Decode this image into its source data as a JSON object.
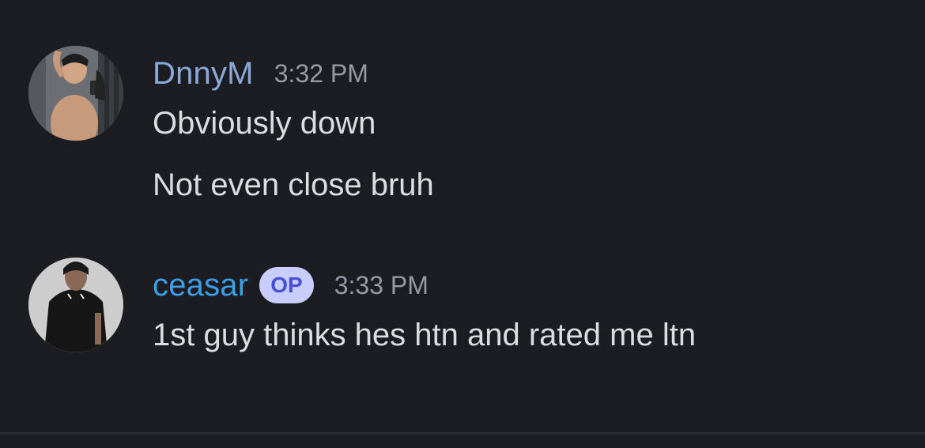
{
  "messages": [
    {
      "author": "DnnyM",
      "author_color": "#8aa9d6",
      "time": "3:32 PM",
      "avatar_icon": "user-avatar-photo",
      "lines": [
        "Obviously down",
        "Not even close bruh"
      ]
    },
    {
      "author": "ceasar",
      "author_color": "#3aa0e8",
      "badge": "OP",
      "time": "3:33 PM",
      "avatar_icon": "user-avatar-photo",
      "lines": [
        "1st guy thinks hes htn and rated me ltn"
      ]
    }
  ],
  "colors": {
    "background": "#1c1d22",
    "message_text": "#dbdee1",
    "timestamp": "#949ba4",
    "badge_bg": "#c9cdfb",
    "badge_text": "#4650d8"
  }
}
